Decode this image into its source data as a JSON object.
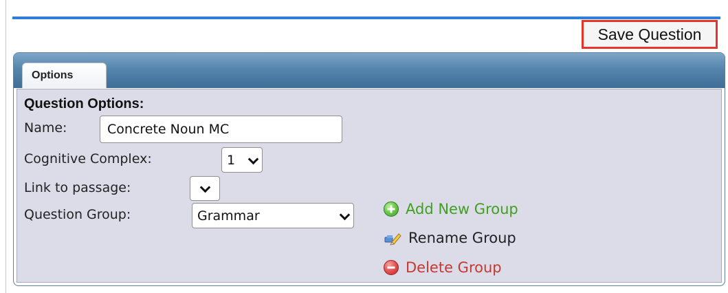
{
  "toolbar": {
    "save_label": "Save Question"
  },
  "tabs": [
    {
      "label": "Options"
    }
  ],
  "question_options": {
    "title": "Question Options:",
    "name_label": "Name:",
    "name_value": "Concrete Noun MC",
    "cognitive_complex_label": "Cognitive Complex:",
    "cognitive_complex_value": "1",
    "link_to_passage_label": "Link to passage:",
    "link_to_passage_value": "",
    "question_group_label": "Question Group:",
    "question_group_value": "Grammar"
  },
  "group_actions": {
    "add_label": "Add New Group",
    "rename_label": "Rename Group",
    "delete_label": "Delete Group"
  },
  "icons": {
    "add": "add-circle-icon",
    "rename": "rename-pencil-icon",
    "delete": "delete-circle-icon",
    "dropdown": "chevron-down-icon"
  },
  "colors": {
    "accent_blue": "#2f7ed8",
    "save_border": "#e5342b",
    "add_green": "#3fa020",
    "delete_red": "#c43a32",
    "body_bg": "#dcdbe8"
  }
}
